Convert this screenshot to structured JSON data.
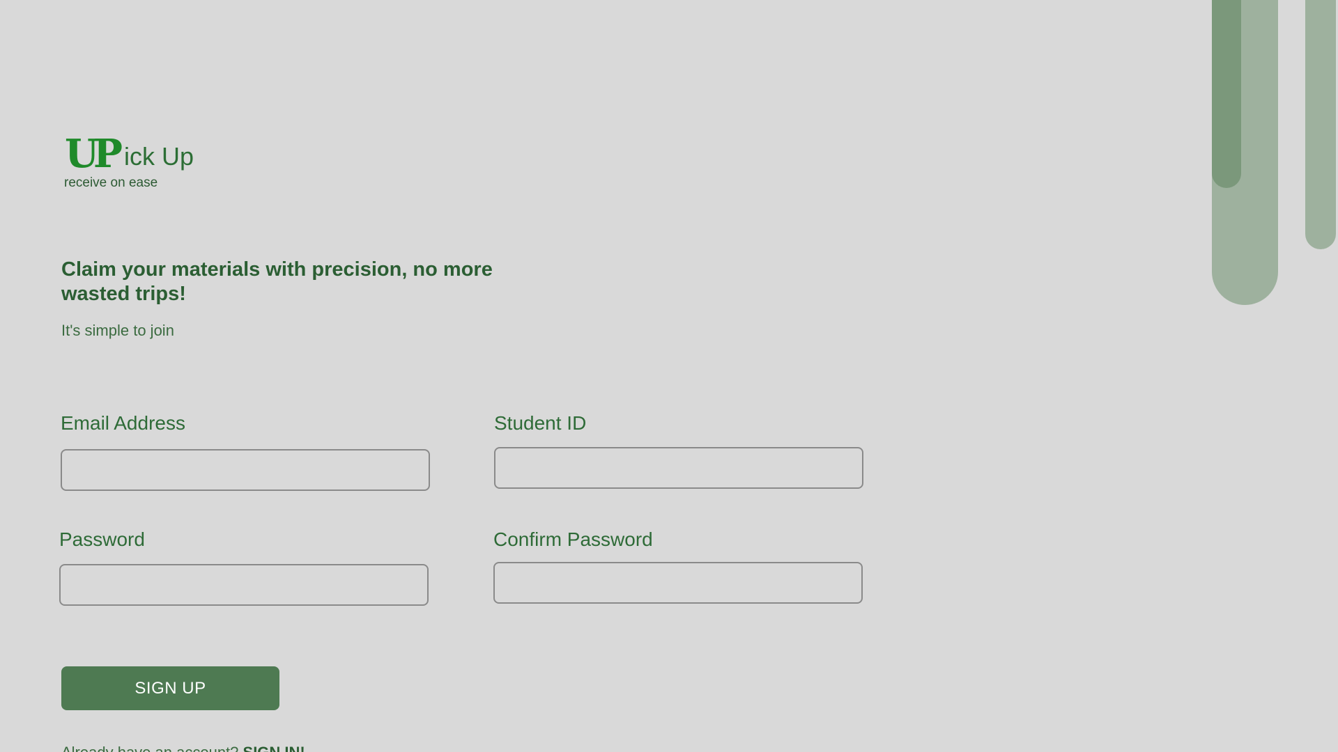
{
  "brand": {
    "logo_mark": "UP",
    "name": "ick Up",
    "tagline": "receive on ease",
    "accent_color": "#1f8a2a",
    "text_color": "#2c6e35"
  },
  "hero": {
    "headline": "Claim your materials with precision, no more wasted trips!",
    "subhead": "It's simple to join"
  },
  "form": {
    "email": {
      "label": "Email Address",
      "value": "",
      "placeholder": ""
    },
    "student_id": {
      "label": "Student ID",
      "value": "",
      "placeholder": ""
    },
    "password": {
      "label": "Password",
      "value": "",
      "placeholder": ""
    },
    "confirm_password": {
      "label": "Confirm Password",
      "value": "",
      "placeholder": ""
    },
    "submit_label": "SIGN UP",
    "submit_color": "#4e7a52"
  },
  "footer": {
    "prompt": "Already have an account? ",
    "link": "SIGN IN!"
  },
  "colors": {
    "background": "#d9d9d9",
    "decor_light": "#9eb19e",
    "decor_dark": "#7b987b"
  }
}
